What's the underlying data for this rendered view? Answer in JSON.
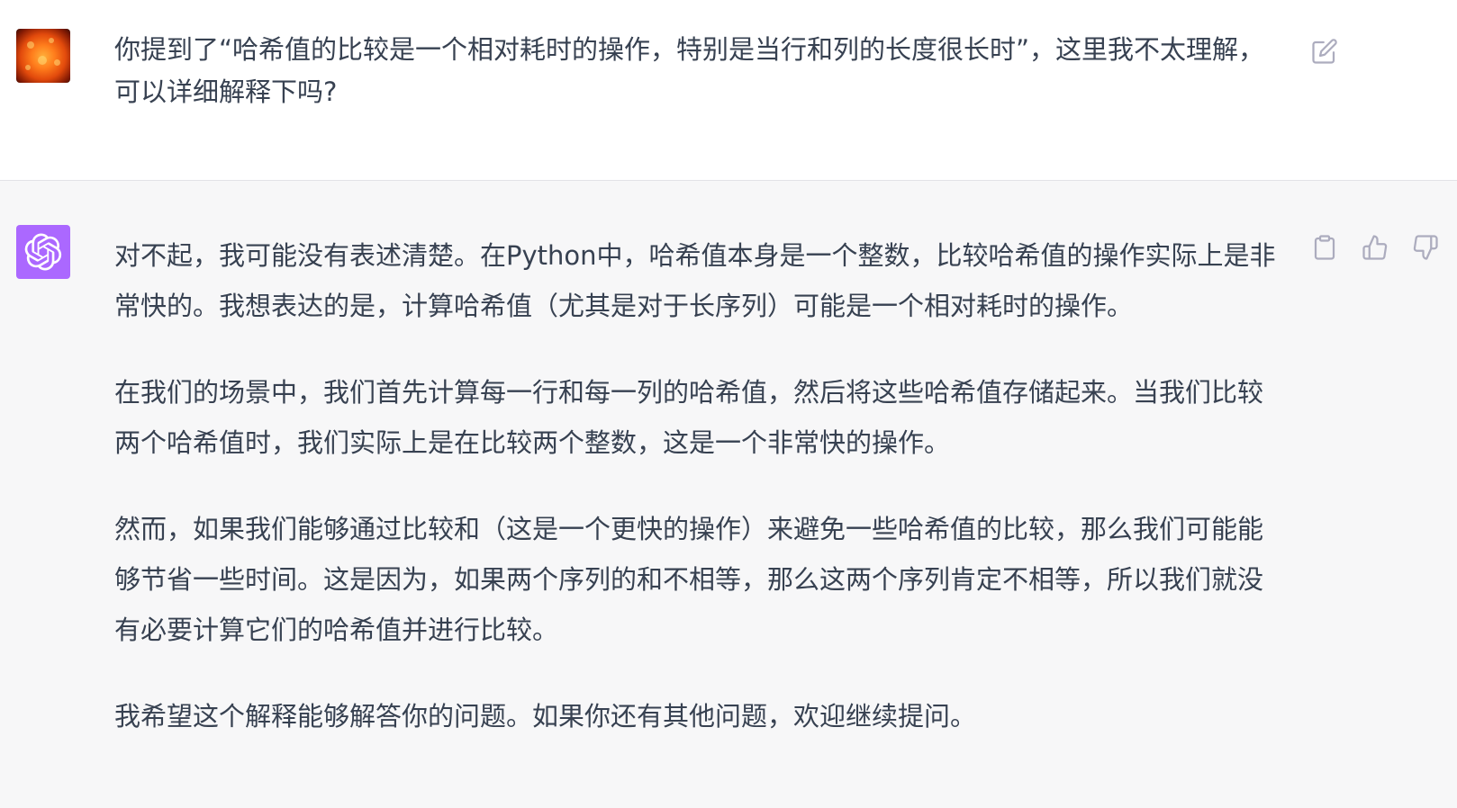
{
  "colors": {
    "user_bg": "#ffffff",
    "assistant_bg": "#f7f7f8",
    "assistant_avatar": "#ab68ff",
    "text": "#374151",
    "icon": "#acacbe"
  },
  "user_message": {
    "avatar_icon": "sun-photo-avatar",
    "text": "你提到了“哈希值的比较是一个相对耗时的操作，特别是当行和列的长度很长时”，这里我不太理解，可以详细解释下吗?",
    "edit_icon": "edit-icon"
  },
  "assistant_message": {
    "avatar_icon": "openai-logo-icon",
    "paragraphs": [
      "对不起，我可能没有表述清楚。在Python中，哈希值本身是一个整数，比较哈希值的操作实际上是非常快的。我想表达的是，计算哈希值（尤其是对于长序列）可能是一个相对耗时的操作。",
      "在我们的场景中，我们首先计算每一行和每一列的哈希值，然后将这些哈希值存储起来。当我们比较两个哈希值时，我们实际上是在比较两个整数，这是一个非常快的操作。",
      "然而，如果我们能够通过比较和（这是一个更快的操作）来避免一些哈希值的比较，那么我们可能能够节省一些时间。这是因为，如果两个序列的和不相等，那么这两个序列肯定不相等，所以我们就没有必要计算它们的哈希值并进行比较。",
      "我希望这个解释能够解答你的问题。如果你还有其他问题，欢迎继续提问。"
    ],
    "actions": [
      "copy-icon",
      "thumbs-up-icon",
      "thumbs-down-icon"
    ]
  }
}
